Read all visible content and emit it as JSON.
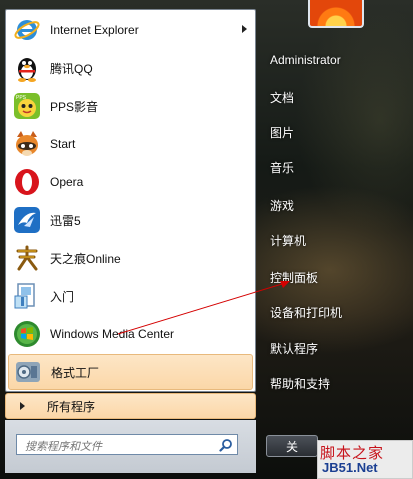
{
  "programs": [
    {
      "label": "Internet Explorer",
      "icon": "internet-explorer-icon"
    },
    {
      "label": "腾讯QQ",
      "icon": "qq-penguin-icon"
    },
    {
      "label": "PPS影音",
      "icon": "pps-icon"
    },
    {
      "label": "Start",
      "icon": "start-raccoon-icon"
    },
    {
      "label": "Opera",
      "icon": "opera-icon"
    },
    {
      "label": "迅雷5",
      "icon": "thunder-icon"
    },
    {
      "label": "天之痕Online",
      "icon": "game-icon"
    },
    {
      "label": "入门",
      "icon": "getting-started-icon"
    },
    {
      "label": "Windows Media Center",
      "icon": "media-center-icon"
    },
    {
      "label": "格式工厂",
      "icon": "format-factory-icon"
    }
  ],
  "all_programs": "所有程序",
  "search": {
    "placeholder": "搜索程序和文件"
  },
  "right": {
    "user": "Administrator",
    "documents": "文档",
    "pictures": "图片",
    "music": "音乐",
    "games": "游戏",
    "computer": "计算机",
    "control_panel": "控制面板",
    "devices": "设备和打印机",
    "default_programs": "默认程序",
    "help": "帮助和支持"
  },
  "shutdown": "关",
  "watermark": {
    "line1": "脚本之家",
    "line2": "JB51.Net"
  },
  "colors": {
    "highlight": "#fbd7a8",
    "arrow": "#d40000"
  }
}
